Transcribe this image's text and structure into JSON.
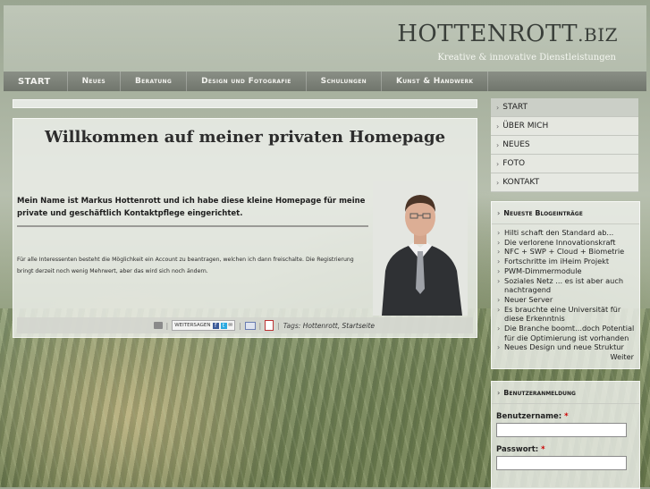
{
  "header": {
    "logo_main": "HOTTENROTT",
    "logo_ext": ".BIZ",
    "tagline": "Kreative & innovative Dienstleistungen"
  },
  "nav": {
    "items": [
      "START",
      "Neues",
      "Beratung",
      "Design und Fotografie",
      "Schulungen",
      "Kunst & Handwerk"
    ]
  },
  "main": {
    "title": "Willkommen auf meiner privaten Homepage",
    "intro": "Mein Name ist Markus Hottenrott und ich habe diese kleine Homepage für meine private und geschäftlich Kontaktpflege eingerichtet.",
    "body": "Für alle Interessenten besteht die Möglichkeit ein Account zu beantragen, welchen ich dann freischalte. Die Registrierung bringt derzeit noch wenig Mehrwert, aber das wird sich noch ändern.",
    "share_label": "WEITERSAGEN",
    "tags_label": "Tags:",
    "tags": [
      "Hottenrott",
      "Startseite"
    ]
  },
  "sidebar": {
    "menu": [
      "START",
      "ÜBER MICH",
      "NEUES",
      "FOTO",
      "KONTAKT"
    ],
    "blog_title": "Neueste Blogeinträge",
    "blog_items": [
      "Hilti schaft den Standard ab...",
      "Die verlorene Innovationskraft",
      "NFC + SWP + Cloud + Biometrie",
      "Fortschritte im iHeim Projekt",
      "PWM-Dimmermodule",
      "Soziales Netz ... es ist aber auch nachtragend",
      "Neuer Server",
      "Es brauchte eine Universität für diese Erkenntnis",
      "Die Branche boomt...doch Potential für die Optimierung ist vorhanden",
      "Neues Design und neue Struktur"
    ],
    "blog_more": "Weiter",
    "login_title": "Benutzeranmeldung",
    "username_label": "Benutzername:",
    "password_label": "Passwort:",
    "required_mark": "*"
  },
  "colors": {
    "nav_bg": "#7a7f76",
    "panel_bg": "#eef0eb",
    "required": "#cc0000"
  }
}
